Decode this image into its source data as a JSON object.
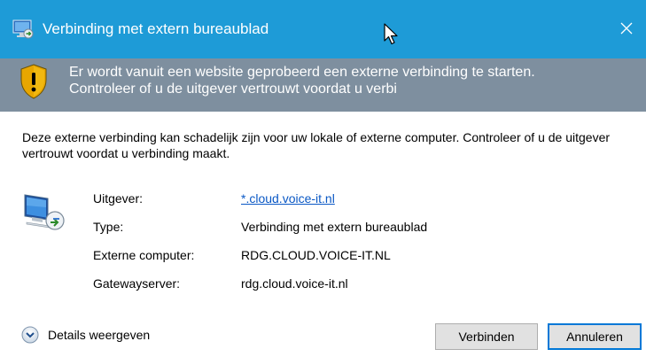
{
  "window": {
    "title": "Verbinding met extern bureaublad",
    "close_symbol": "✕"
  },
  "banner": {
    "line1": "Er wordt vanuit een website geprobeerd een externe verbinding te starten.",
    "line2": "Controleer of u de uitgever vertrouwt voordat u verbi",
    "background": "#7e8f9f"
  },
  "message": "Deze externe verbinding kan schadelijk zijn voor uw lokale of externe computer. Controleer of u de uitgever vertrouwt voordat u verbinding maakt.",
  "details": [
    {
      "label": "Uitgever:",
      "value": "*.cloud.voice-it.nl",
      "is_link": true
    },
    {
      "label": "Type:",
      "value": "Verbinding met extern bureaublad",
      "is_link": false
    },
    {
      "label": "Externe computer:",
      "value": "RDG.CLOUD.VOICE-IT.NL",
      "is_link": false
    },
    {
      "label": "Gatewayserver:",
      "value": "rdg.cloud.voice-it.nl",
      "is_link": false
    }
  ],
  "footer": {
    "details_toggle": "Details weergeven",
    "connect_button": "Verbinden",
    "cancel_button": "Annuleren"
  },
  "colors": {
    "titlebar": "#1e9bd7",
    "link": "#0a58c5",
    "focus_border": "#0078d7"
  },
  "icons": {
    "app": "remote-desktop-icon",
    "warning": "warning-shield-icon",
    "computer": "remote-computer-icon",
    "details": "chevron-down-icon",
    "close": "close-icon"
  }
}
